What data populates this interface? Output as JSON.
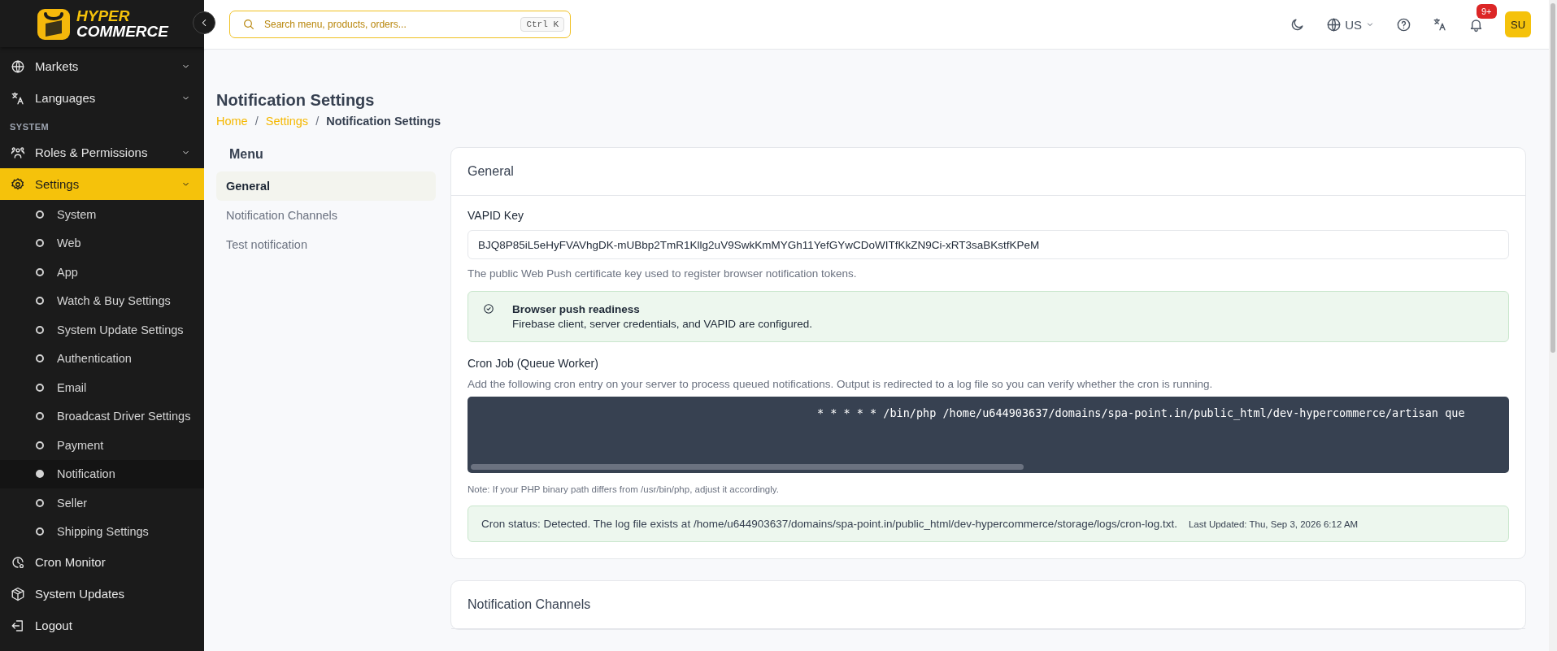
{
  "sidebar": {
    "logo": {
      "line_1": "HYPER",
      "line_2": "COMMERCE"
    },
    "items": [
      {
        "kind": "group",
        "label": "Markets",
        "selected": false
      },
      {
        "kind": "group",
        "label": "Languages",
        "selected": false
      },
      {
        "kind": "section",
        "label": "SYSTEM"
      },
      {
        "kind": "group",
        "label": "Roles & Permissions",
        "selected": false
      },
      {
        "kind": "group",
        "label": "Settings",
        "selected": true,
        "children": [
          {
            "label": "System",
            "selected": false
          },
          {
            "label": "Web",
            "selected": false
          },
          {
            "label": "App",
            "selected": false
          },
          {
            "label": "Watch & Buy Settings",
            "selected": false
          },
          {
            "label": "System Update Settings",
            "selected": false
          },
          {
            "label": "Authentication",
            "selected": false
          },
          {
            "label": "Email",
            "selected": false
          },
          {
            "label": "Broadcast Driver Settings",
            "selected": false
          },
          {
            "label": "Payment",
            "selected": false
          },
          {
            "label": "Notification",
            "selected": true
          },
          {
            "label": "Seller",
            "selected": false
          },
          {
            "label": "Shipping Settings",
            "selected": false
          }
        ]
      },
      {
        "kind": "link",
        "label": "Cron Monitor",
        "selected": false
      },
      {
        "kind": "link",
        "label": "System Updates",
        "selected": false
      },
      {
        "kind": "link",
        "label": "Logout",
        "selected": false
      }
    ]
  },
  "header": {
    "search": {
      "placeholder": "Search menu, products, orders...",
      "shortcut": "Ctrl K"
    },
    "language": "US",
    "notifications_badge": "9+",
    "avatar": "SU"
  },
  "page": {
    "title": "Notification Settings",
    "breadcrumb_separator": "/",
    "breadcrumb": [
      {
        "label": "Home",
        "current": false
      },
      {
        "label": "Settings",
        "current": false
      },
      {
        "label": "Notification Settings",
        "current": true
      }
    ]
  },
  "menu": {
    "title": "Menu",
    "items": [
      {
        "label": "General",
        "selected": true
      },
      {
        "label": "Notification Channels",
        "selected": false
      },
      {
        "label": "Test notification",
        "selected": false
      }
    ]
  },
  "general": {
    "title": "General",
    "vapid_label": "VAPID Key",
    "vapid_value": "BJQ8P85iL5eHyFVAVhgDK-mUBbp2TmR1Kllg2uV9SwkKmMYGh11YefGYwCDoWITfKkZN9Ci-xRT3saBKstfKPeM",
    "vapid_help": "The public Web Push certificate key used to register browser notification tokens.",
    "readiness": {
      "title": "Browser push readiness",
      "text": "Firebase client, server credentials, and VAPID are configured."
    },
    "cron_label": "Cron Job (Queue Worker)",
    "cron_description": "Add the following cron entry on your server to process queued notifications. Output is redirected to a log file so you can verify whether the cron is running.",
    "cron_command": "* * * * * /bin/php /home/u644903637/domains/spa-point.in/public_html/dev-hypercommerce/artisan que",
    "cron_note": "Note: If your PHP binary path differs from /usr/bin/php, adjust it accordingly.",
    "cron_status": "Cron status: Detected. The log file exists at /home/u644903637/domains/spa-point.in/public_html/dev-hypercommerce/storage/logs/cron-log.txt.",
    "last_updated": "Last Updated: Thu, Sep 3, 2026 6:12 AM"
  },
  "channels": {
    "title": "Notification Channels"
  }
}
